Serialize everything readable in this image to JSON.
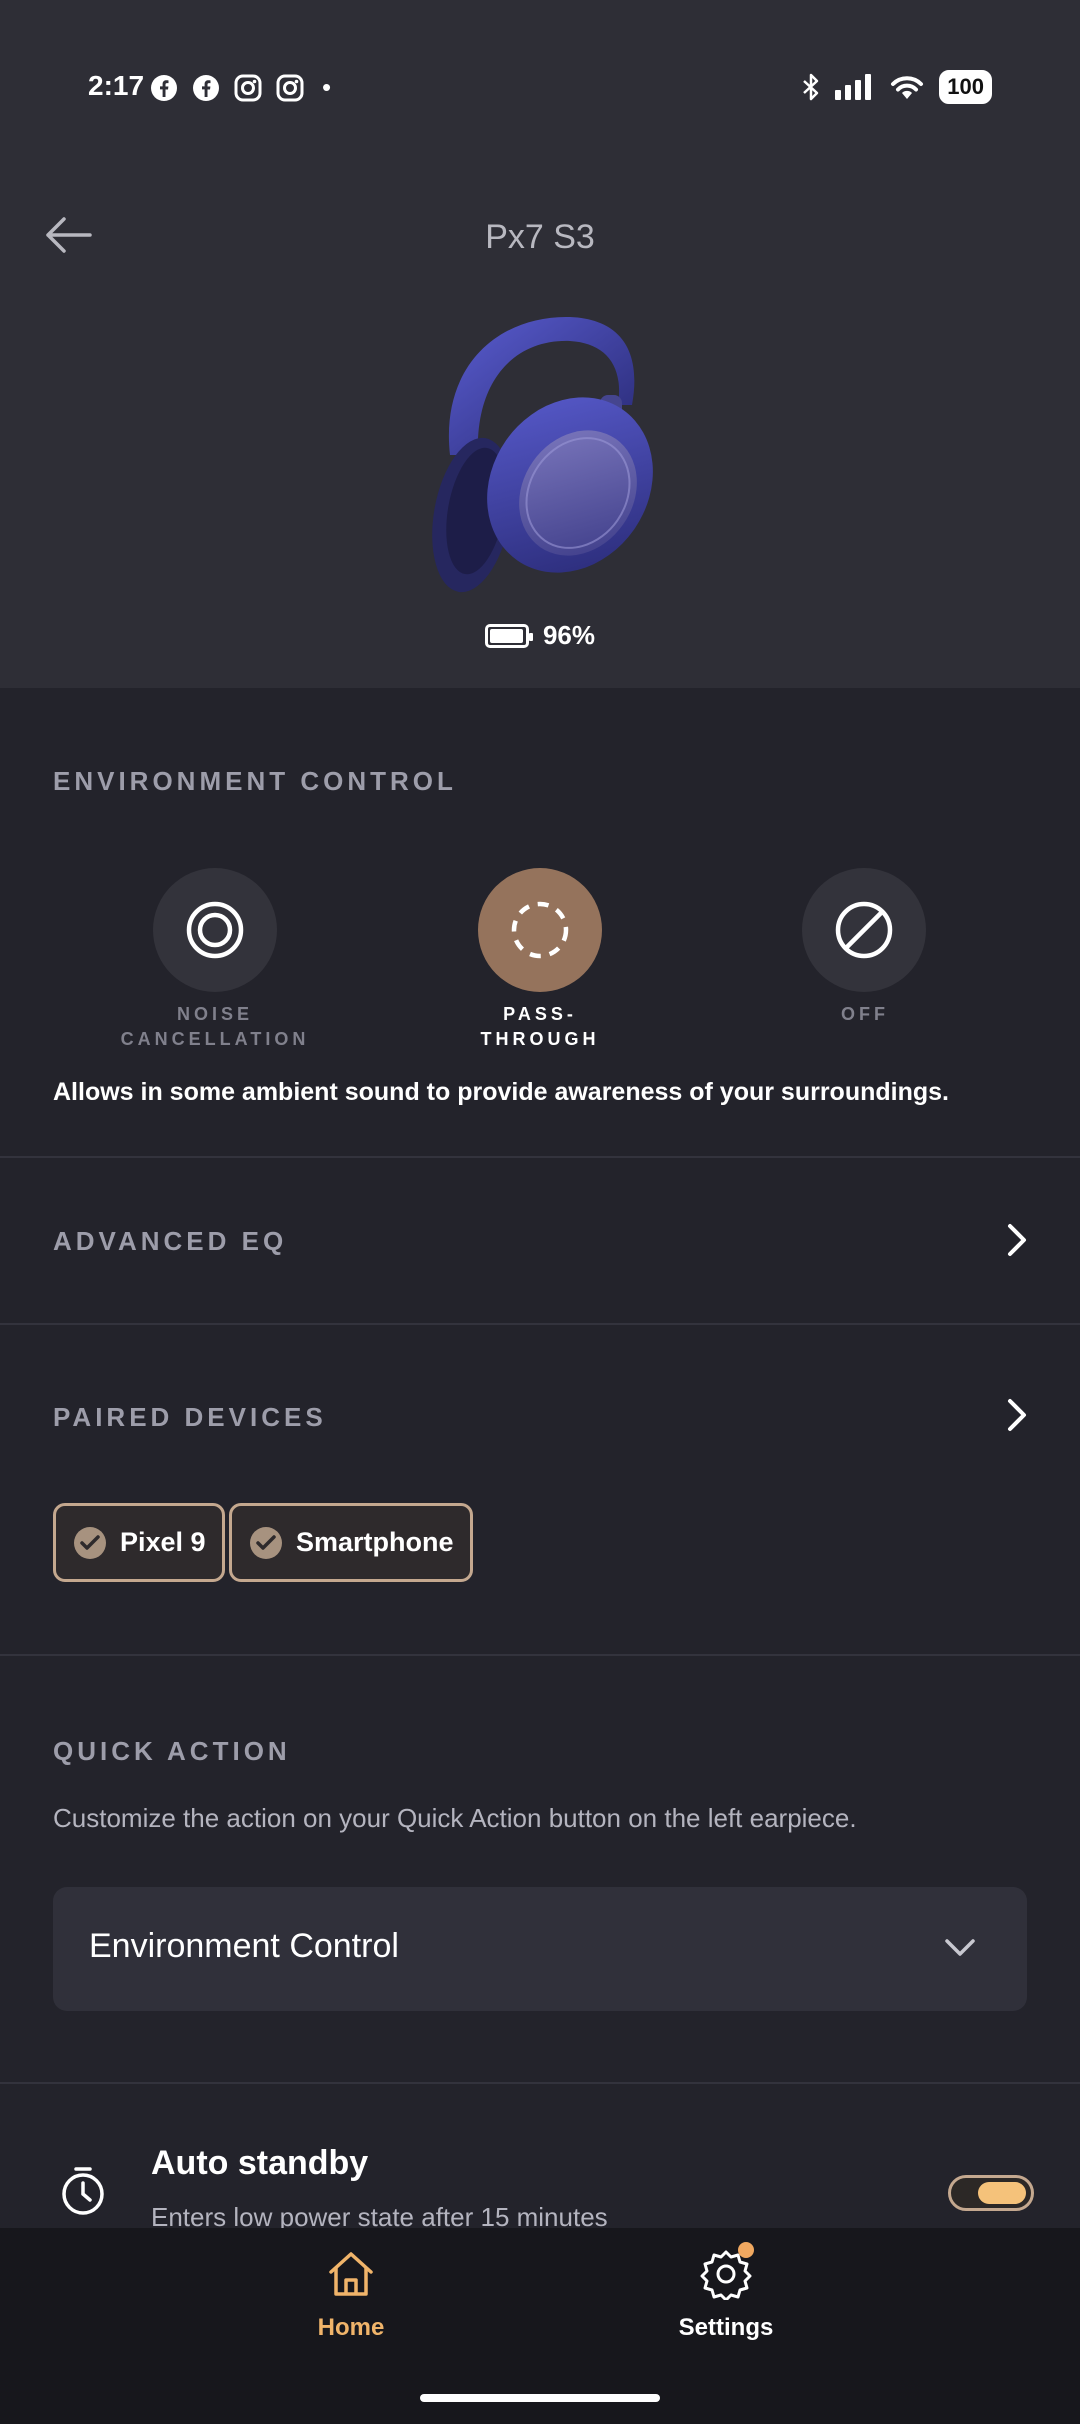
{
  "status_bar": {
    "time": "2:17",
    "apps": [
      "facebook-icon",
      "facebook-icon",
      "instagram-icon",
      "instagram-icon"
    ],
    "dot": "•",
    "battery": "100"
  },
  "header": {
    "title": "Px7 S3",
    "battery_percent": "96%",
    "battery_level": 0.96
  },
  "environment_control": {
    "label": "ENVIRONMENT CONTROL",
    "modes": [
      {
        "label_line1": "NOISE",
        "label_line2": "CANCELLATION",
        "active": false
      },
      {
        "label_line1": "PASS-",
        "label_line2": "THROUGH",
        "active": true
      },
      {
        "label_line1": "OFF",
        "label_line2": "",
        "active": false
      }
    ],
    "description": "Allows in some ambient sound to provide awareness of your surroundings."
  },
  "advanced_eq": {
    "label": "ADVANCED EQ"
  },
  "paired_devices": {
    "label": "PAIRED DEVICES",
    "devices": [
      "Pixel 9",
      "Smartphone"
    ]
  },
  "quick_action": {
    "label": "QUICK ACTION",
    "description": "Customize the action on your Quick Action button on the left earpiece.",
    "selected": "Environment Control"
  },
  "auto_standby": {
    "title": "Auto standby",
    "subtitle": "Enters low power state after 15 minutes",
    "enabled": true
  },
  "bottom_nav": {
    "home": "Home",
    "settings": "Settings"
  },
  "colors": {
    "accent": "#f0b46a",
    "active_mode": "#95735c",
    "chip_border": "#c4a88f"
  }
}
